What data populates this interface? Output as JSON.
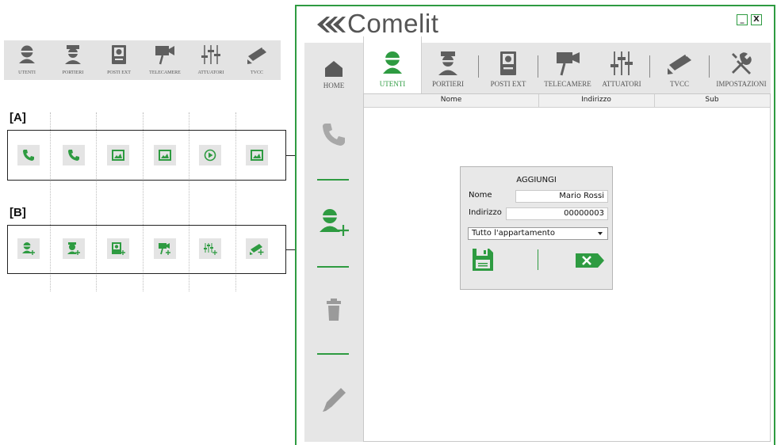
{
  "legend": {
    "tabs": [
      {
        "label": "UTENTI",
        "icon": "user-icon"
      },
      {
        "label": "PORTIERI",
        "icon": "concierge-icon"
      },
      {
        "label": "POSTI EXT",
        "icon": "outdoor-station-icon"
      },
      {
        "label": "TELECAMERE",
        "icon": "camera-icon"
      },
      {
        "label": "ATTUATORI",
        "icon": "actuators-icon"
      },
      {
        "label": "TVCC",
        "icon": "cctv-icon"
      }
    ],
    "section_a": {
      "label": "[A]",
      "buttons": [
        "call-icon",
        "call-icon",
        "image-icon",
        "image-icon",
        "play-icon",
        "image-icon"
      ]
    },
    "section_b": {
      "label": "[B]",
      "buttons": [
        "add-user-icon",
        "add-concierge-icon",
        "add-outdoor-station-icon",
        "add-camera-icon",
        "add-actuator-icon",
        "add-cctv-icon"
      ]
    }
  },
  "app": {
    "logo_text": "Comelit",
    "window_controls": {
      "minimize": "_",
      "close": "X"
    },
    "accent_color": "#2e9b41",
    "sidebar": {
      "home_label": "HOME",
      "actions": [
        "call-icon",
        "add-user-icon",
        "trash-icon",
        "edit-pencil-icon"
      ]
    },
    "tabs": [
      {
        "label": "UTENTI",
        "icon": "user-icon",
        "active": true
      },
      {
        "label": "PORTIERI",
        "icon": "concierge-icon",
        "active": false
      },
      {
        "label": "POSTI EXT",
        "icon": "outdoor-station-icon",
        "active": false
      },
      {
        "label": "TELECAMERE",
        "icon": "camera-icon",
        "active": false
      },
      {
        "label": "ATTUATORI",
        "icon": "actuators-icon",
        "active": false
      },
      {
        "label": "TVCC",
        "icon": "cctv-icon",
        "active": false
      },
      {
        "label": "IMPOSTAZIONI",
        "icon": "settings-tools-icon",
        "active": false
      }
    ],
    "table": {
      "columns": [
        "Nome",
        "Indirizzo",
        "Sub"
      ]
    },
    "dialog": {
      "title": "AGGIUNGI",
      "name_label": "Nome",
      "name_value": "Mario Rossi",
      "address_label": "Indirizzo",
      "address_value": "00000003",
      "select_value": "Tutto l'appartamento",
      "save_icon": "save-icon",
      "cancel_icon": "cancel-x-icon"
    }
  }
}
